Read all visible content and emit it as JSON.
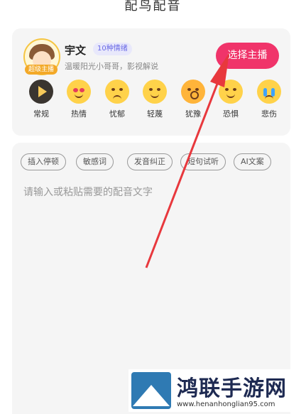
{
  "app": {
    "title": "配鸟配音"
  },
  "voice": {
    "name": "宇文",
    "tag": "10种情绪",
    "description": "温暖阳光小哥哥，影视解说",
    "badge": "超级主播",
    "select_label": "选择主播"
  },
  "emotions": [
    {
      "label": "常规",
      "icon": "play-icon"
    },
    {
      "label": "热情",
      "icon": "heart-eyes-emoji-icon"
    },
    {
      "label": "忧郁",
      "icon": "sad-emoji-icon"
    },
    {
      "label": "轻蔑",
      "icon": "smirk-emoji-icon"
    },
    {
      "label": "犹豫",
      "icon": "thinking-emoji-icon"
    },
    {
      "label": "恐惧",
      "icon": "fear-emoji-icon"
    },
    {
      "label": "悲伤",
      "icon": "crying-emoji-icon"
    }
  ],
  "editor": {
    "tools": [
      "插入停顿",
      "敏感词",
      "发音纠正",
      "短句试听",
      "AI文案"
    ],
    "placeholder": "请输入或粘贴需要的配音文字"
  },
  "watermark": {
    "title": "鸿联手游网",
    "url": "www.henanhonglian95.com"
  },
  "colors": {
    "accent": "#f0346a",
    "tag": "#6a6ae6",
    "card_bg": "#f5f5f5"
  }
}
